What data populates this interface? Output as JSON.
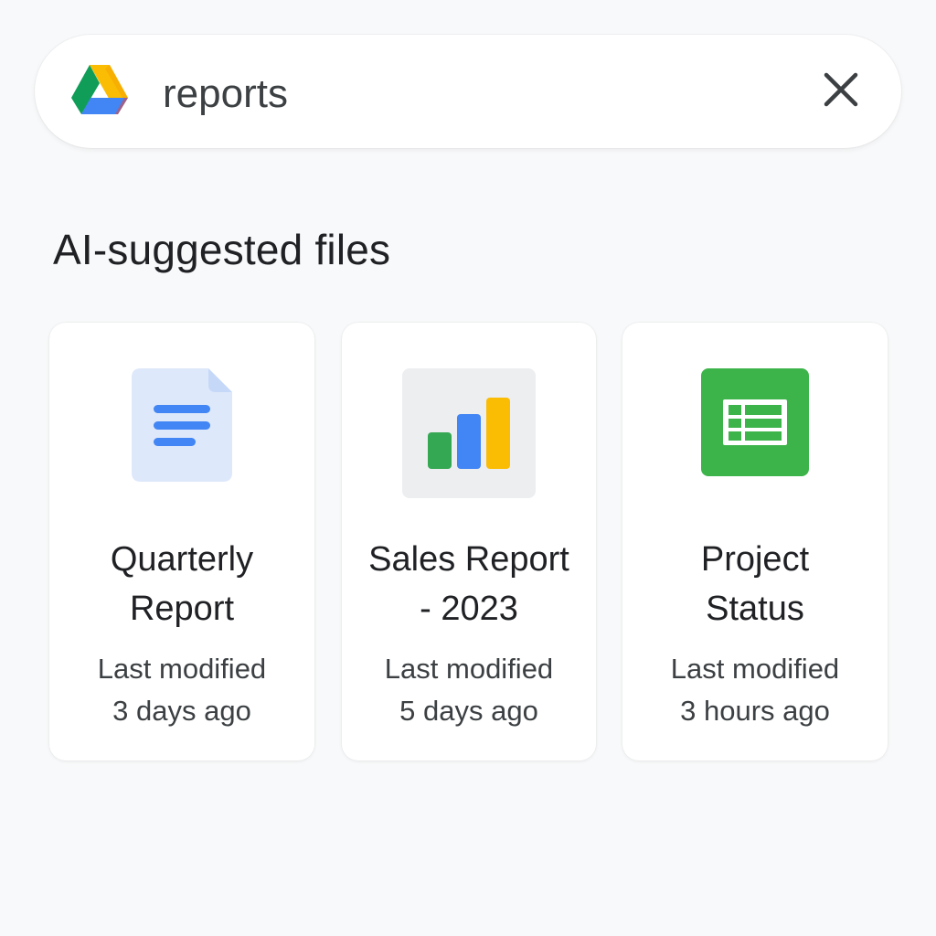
{
  "search": {
    "query": "reports",
    "logo_icon": "google-drive-logo-icon",
    "clear_icon": "close-icon"
  },
  "section": {
    "title": "AI-suggested files"
  },
  "files": [
    {
      "icon": "google-docs-icon",
      "title_line1": "Quarterly",
      "title_line2": "Report",
      "meta_line1": "Last modified",
      "meta_line2": "3 days ago",
      "color": "#4285f4"
    },
    {
      "icon": "bar-chart-icon",
      "title_line1": "Sales Report",
      "title_line2": "- 2023",
      "meta_line1": "Last modified",
      "meta_line2": "5 days ago",
      "color": "#fbbc04"
    },
    {
      "icon": "google-sheets-icon",
      "title_line1": "Project",
      "title_line2": "Status",
      "meta_line1": "Last modified",
      "meta_line2": "3 hours ago",
      "color": "#34a853"
    }
  ],
  "colors": {
    "background": "#f8f9fa",
    "drive_green": "#0f9d58",
    "drive_blue": "#4285f4",
    "drive_yellow": "#fbbc04",
    "docs_blue": "#4285f4",
    "sheets_green": "#34a853"
  }
}
